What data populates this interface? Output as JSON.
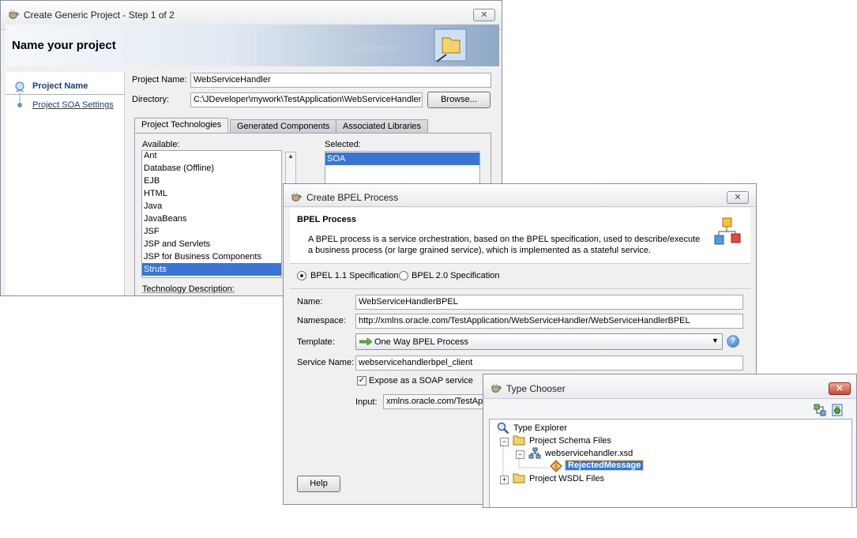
{
  "project_wizard": {
    "title": "Create Generic Project - Step 1 of 2",
    "header": "Name your project",
    "steps": [
      {
        "label": "Project Name"
      },
      {
        "label": "Project SOA Settings"
      }
    ],
    "project_name_label": "Project Name:",
    "project_name_value": "WebServiceHandler",
    "directory_label": "Directory:",
    "directory_value": "C:\\JDeveloper\\mywork\\TestApplication\\WebServiceHandler",
    "browse_label": "Browse...",
    "tabs": [
      "Project Technologies",
      "Generated Components",
      "Associated Libraries"
    ],
    "available_label": "Available:",
    "selected_label": "Selected:",
    "available_items": [
      "Ant",
      "Database (Offline)",
      "EJB",
      "HTML",
      "Java",
      "JavaBeans",
      "JSF",
      "JSP and Servlets",
      "JSP for Business Components",
      "Struts"
    ],
    "selected_items": [
      "SOA"
    ],
    "tech_description_label": "Technology Description:"
  },
  "bpel_dialog": {
    "title": "Create BPEL Process",
    "header": "BPEL Process",
    "description": "A BPEL process is a service orchestration, based on the BPEL specification, used to describe/execute a business process (or large grained service), which is implemented as a stateful service.",
    "spec_options": [
      "BPEL 1.1 Specification",
      "BPEL 2.0 Specification"
    ],
    "selected_spec": "BPEL 1.1 Specification",
    "name_label": "Name:",
    "name_value": "WebServiceHandlerBPEL",
    "namespace_label": "Namespace:",
    "namespace_value": "http://xmlns.oracle.com/TestApplication/WebServiceHandler/WebServiceHandlerBPEL",
    "template_label": "Template:",
    "template_value": "One Way BPEL Process",
    "service_name_label": "Service Name:",
    "service_name_value": "webservicehandlerbpel_client",
    "expose_label": "Expose as a SOAP service",
    "expose_checked": true,
    "input_label": "Input:",
    "input_value": "xmlns.oracle.com/TestApplication/WebServiceHandler/WebServiceHandlerBPEL",
    "help_label": "Help"
  },
  "type_chooser": {
    "title": "Type Chooser",
    "tree": {
      "root": "Type Explorer",
      "schema_files": "Project Schema Files",
      "xsd_file": "webservicehandler.xsd",
      "element": "RejectedMessage",
      "wsdl_files": "Project WSDL Files"
    }
  }
}
